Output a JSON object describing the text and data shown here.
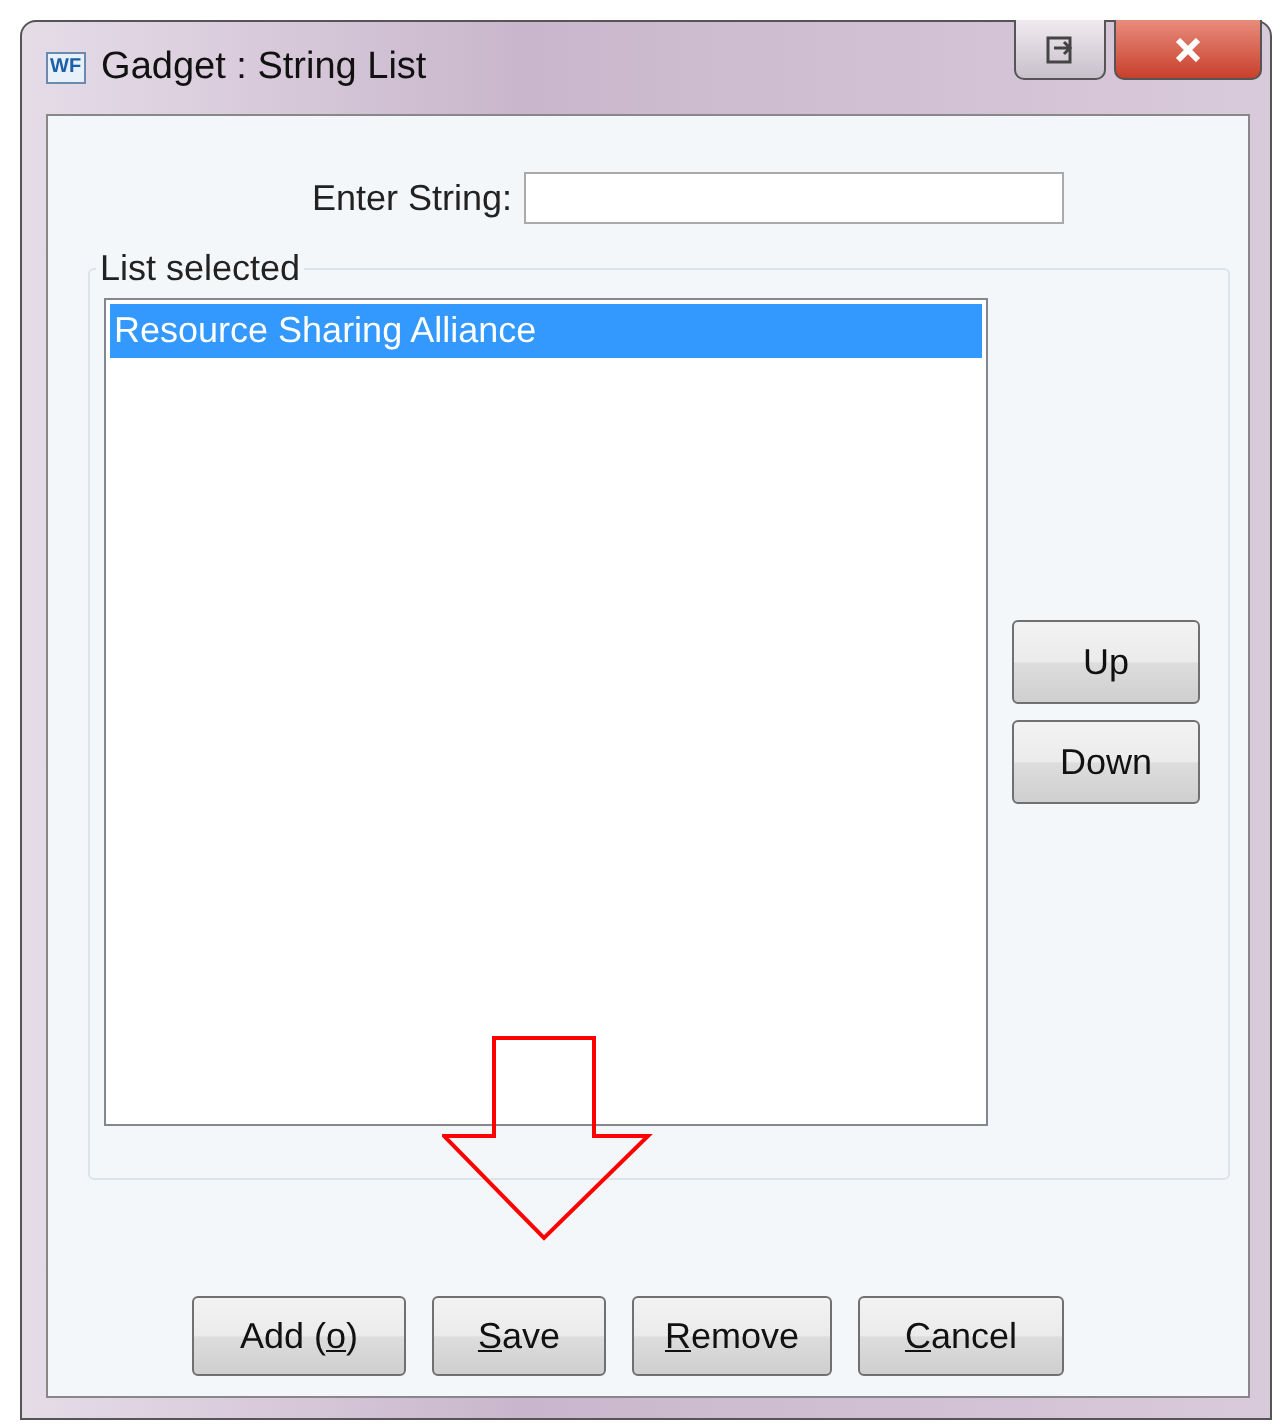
{
  "window": {
    "title": "Gadget : String List",
    "icon_text": "WF"
  },
  "enter_string": {
    "label": "Enter String:"
  },
  "group": {
    "legend": "List selected"
  },
  "list_items": [
    {
      "text": "Resource Sharing Alliance",
      "selected": true
    }
  ],
  "side_buttons": [
    {
      "label": "Up"
    },
    {
      "label": "Down"
    }
  ],
  "buttons": [
    {
      "before": "Add (",
      "key": "o",
      "after": ")"
    },
    {
      "key": "S",
      "after": "ave"
    },
    {
      "key": "R",
      "after": "emove"
    },
    {
      "key": "C",
      "after": "ancel"
    }
  ]
}
